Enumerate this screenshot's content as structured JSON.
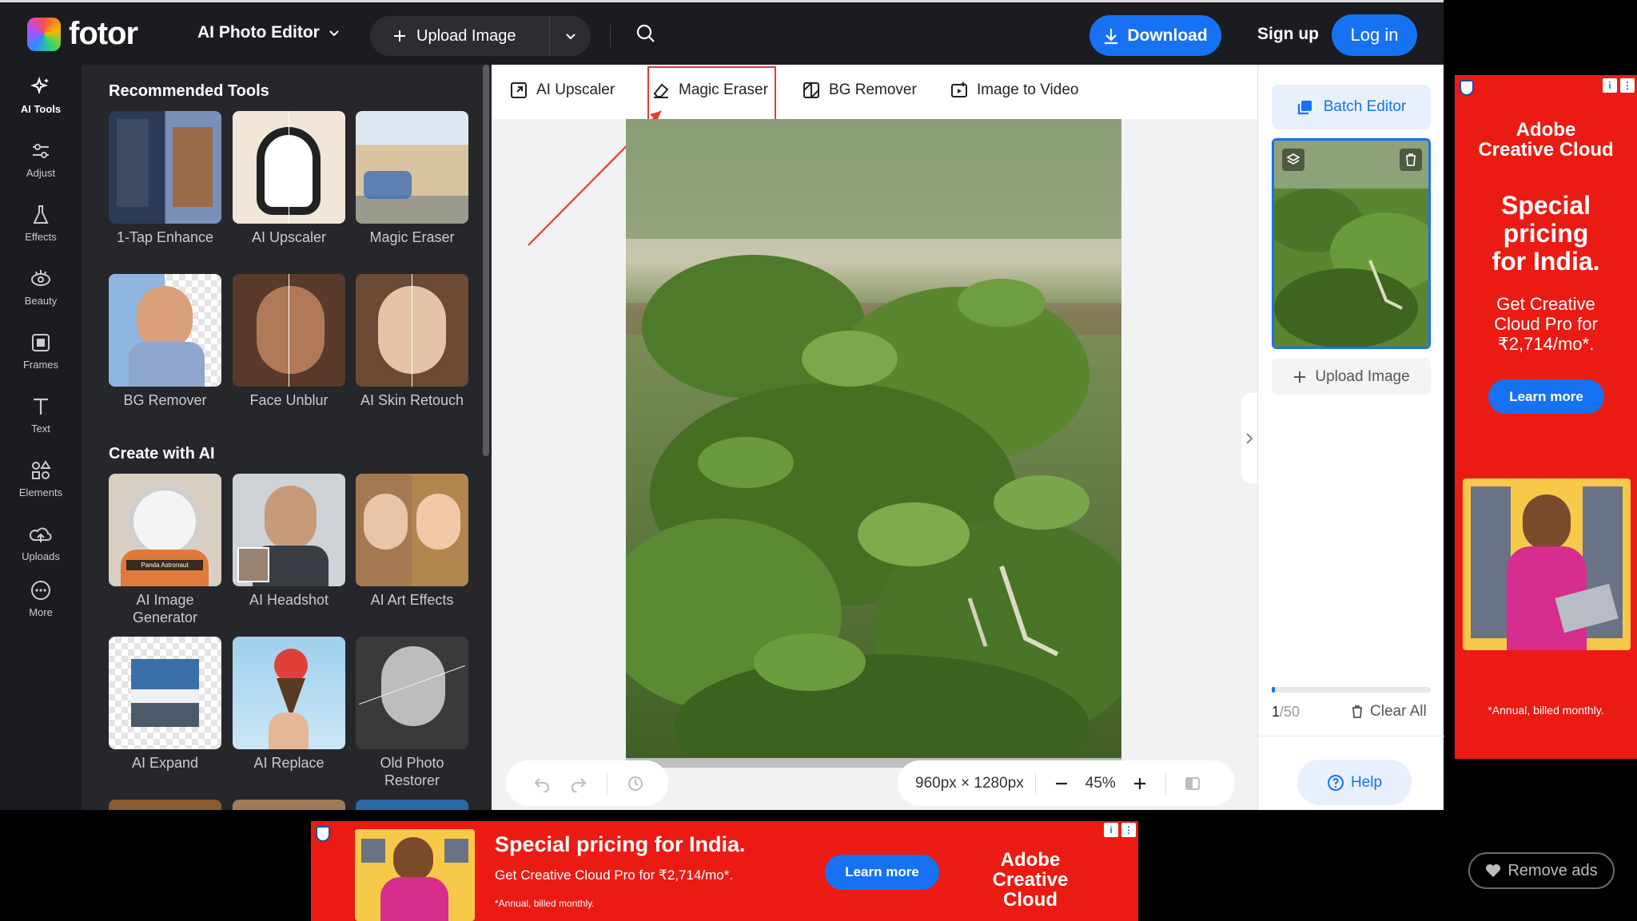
{
  "header": {
    "brand": "fotor",
    "menu_label": "AI Photo Editor",
    "upload_label": "Upload Image",
    "download_label": "Download",
    "signup_label": "Sign up",
    "login_label": "Log in"
  },
  "rail": {
    "items": [
      {
        "label": "AI Tools",
        "icon": "ai-tools-icon"
      },
      {
        "label": "Adjust",
        "icon": "sliders-icon"
      },
      {
        "label": "Effects",
        "icon": "flask-icon"
      },
      {
        "label": "Beauty",
        "icon": "eye-icon"
      },
      {
        "label": "Frames",
        "icon": "frame-icon"
      },
      {
        "label": "Text",
        "icon": "text-icon"
      },
      {
        "label": "Elements",
        "icon": "shapes-icon"
      },
      {
        "label": "Uploads",
        "icon": "cloud-upload-icon"
      },
      {
        "label": "More",
        "icon": "more-icon"
      }
    ]
  },
  "tools": {
    "recommended_title": "Recommended Tools",
    "recommended": [
      "1-Tap Enhance",
      "AI Upscaler",
      "Magic Eraser",
      "BG Remover",
      "Face Unblur",
      "AI Skin Retouch"
    ],
    "create_title": "Create with AI",
    "create": [
      "AI Image Generator",
      "AI Headshot",
      "AI Art Effects",
      "AI Expand",
      "AI Replace",
      "Old Photo Restorer"
    ],
    "panda_caption": "Panda Astronaut"
  },
  "editor": {
    "topbar": [
      "AI Upscaler",
      "Magic Eraser",
      "BG Remover",
      "Image to Video"
    ],
    "dimensions": "960px × 1280px",
    "zoom": "45%"
  },
  "right_panel": {
    "batch_label": "Batch Editor",
    "upload_label": "Upload Image",
    "count_current": "1",
    "count_total": "/50",
    "progress_fraction": 0.02,
    "clear_label": "Clear All",
    "help_label": "Help"
  },
  "side_ad": {
    "brand_line1": "Adobe",
    "brand_line2": "Creative Cloud",
    "headline_1": "Special",
    "headline_2": "pricing",
    "headline_3": "for India.",
    "sub_1": "Get Creative",
    "sub_2": "Cloud Pro for",
    "sub_3": "₹2,714/mo*.",
    "learn_label": "Learn more",
    "fine_print": "*Annual, billed monthly."
  },
  "bottom_ad": {
    "headline": "Special pricing for India.",
    "sub": "Get Creative Cloud Pro for ₹2,714/mo*.",
    "fine_print": "*Annual, billed monthly.",
    "learn_label": "Learn more",
    "brand_line1": "Adobe",
    "brand_line2": "Creative Cloud"
  },
  "remove_ads_label": "Remove ads",
  "colors": {
    "accent": "#1672f3",
    "dark_bg": "#1b1c1f",
    "panel_bg": "#26272b",
    "highlight": "#e53935",
    "ad_red": "#eb1b14"
  }
}
